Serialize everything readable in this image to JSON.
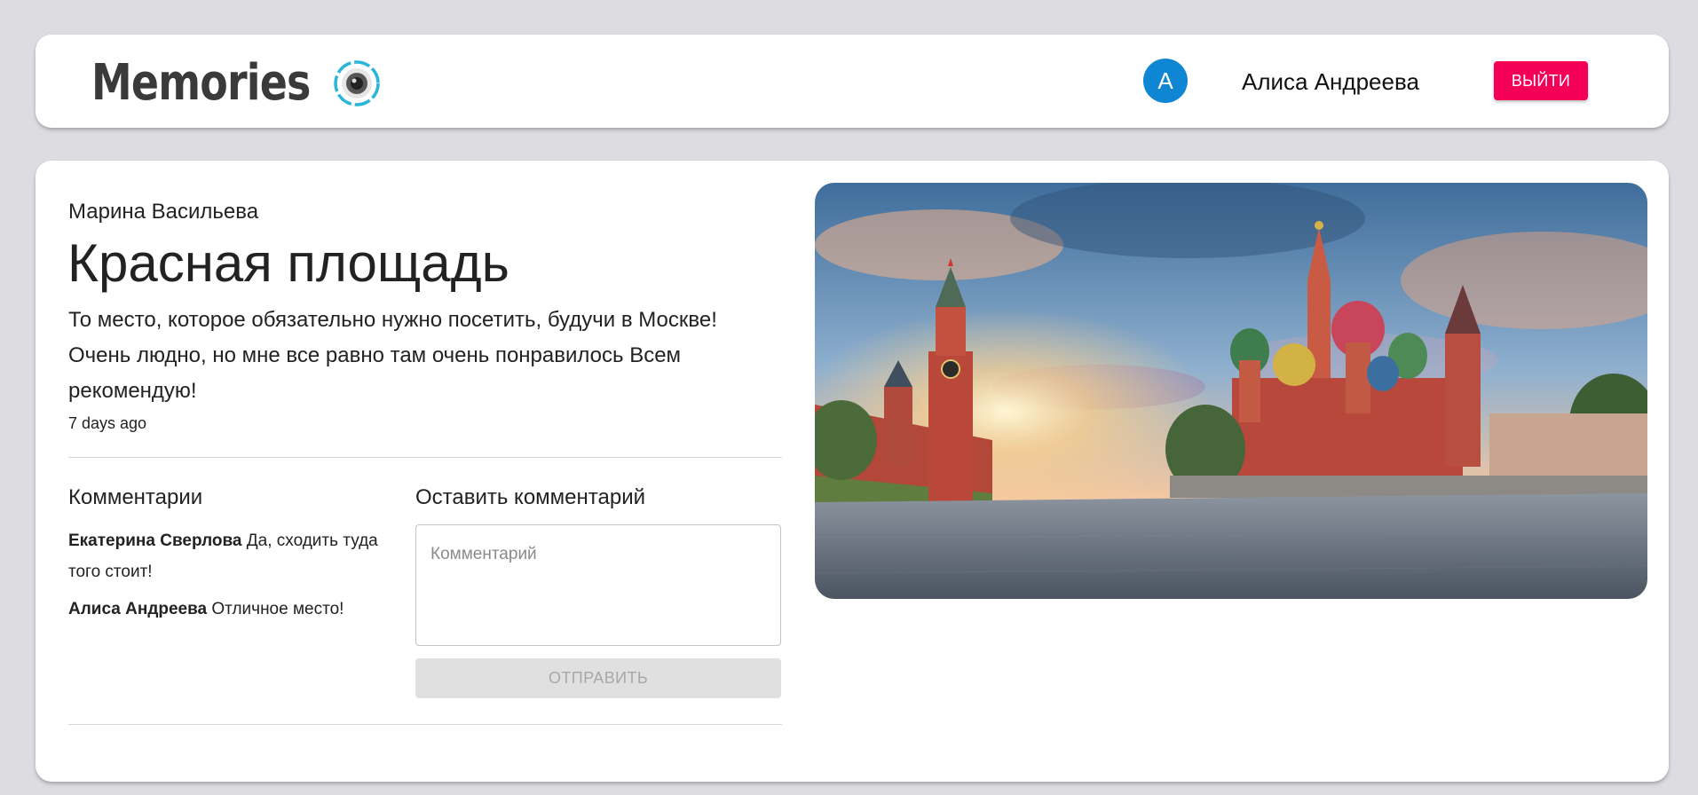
{
  "header": {
    "brand": "Memories",
    "user": {
      "initial": "A",
      "name": "Алиса Андреева"
    },
    "logout_label": "ВЫЙТИ",
    "colors": {
      "avatar": "#0e86d4",
      "logout": "#f50057"
    }
  },
  "post": {
    "author": "Марина Васильева",
    "title": "Красная площадь",
    "message": "То место, которое обязательно нужно посетить, будучи в Москве! Очень людно, но мне все равно там очень понравилось Всем рекомендую!",
    "created": "7 days ago"
  },
  "comments": {
    "heading": "Комментарии",
    "items": [
      {
        "author": "Екатерина Сверлова",
        "text": "Да, сходить туда того стоит!"
      },
      {
        "author": "Алиса Андреева",
        "text": "Отличное место!"
      }
    ]
  },
  "comment_form": {
    "heading": "Оставить комментарий",
    "placeholder": "Комментарий",
    "value": "",
    "submit_label": "ОТПРАВИТЬ"
  }
}
